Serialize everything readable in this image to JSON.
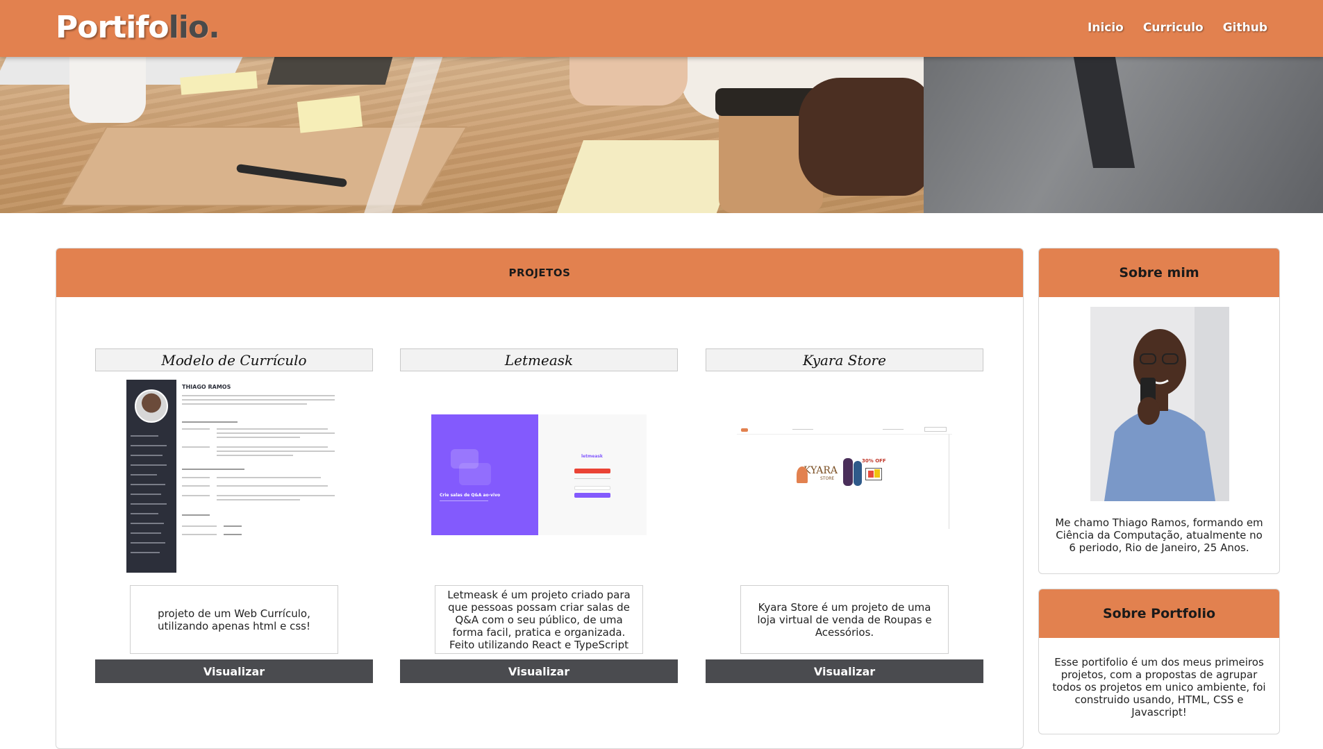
{
  "navbar": {
    "logo_part1": "Portifo",
    "logo_part2": "lio.",
    "links": [
      "Inicio",
      "Curriculo",
      "Github"
    ]
  },
  "projects": {
    "header": "PROJETOS",
    "cards": [
      {
        "title": "Modelo de Currículo",
        "description": "projeto de um Web Currículo, utilizando apenas html e css!",
        "button": "Visualizar",
        "thumb_name": "THIAGO RAMOS"
      },
      {
        "title": "Letmeask",
        "description_lines": [
          "Letmeask é um projeto criado para que pessoas possam criar salas de Q&A com o seu público, de uma forma facil, pratica e organizada.",
          "Feito utilizando React e TypeScript"
        ],
        "button": "Visualizar",
        "thumb_tagline": "Crie salas de Q&A ao-vivo",
        "thumb_logo": "letmeask"
      },
      {
        "title": "Kyara Store",
        "description": "Kyara Store é um projeto de uma loja virtual de venda de Roupas e Acessórios.",
        "button": "Visualizar",
        "thumb_brand": "KYARA",
        "thumb_sub": "STORE",
        "thumb_badge": "30% OFF"
      }
    ]
  },
  "sobre_mim": {
    "header": "Sobre mim",
    "text": "Me chamo Thiago Ramos, formando em Ciência da Computação, atualmente no 6 periodo, Rio de Janeiro, 25 Anos."
  },
  "sobre_portfolio": {
    "header": "Sobre Portfolio",
    "text": "Esse portifolio é um dos meus primeiros projetos, com a propostas de agrupar todos os projetos em unico ambiente, foi construido usando, HTML, CSS e Javascript!"
  },
  "colors": {
    "accent": "#e2814f",
    "button": "#4a4b4f",
    "letmeask_purple": "#835afd"
  }
}
